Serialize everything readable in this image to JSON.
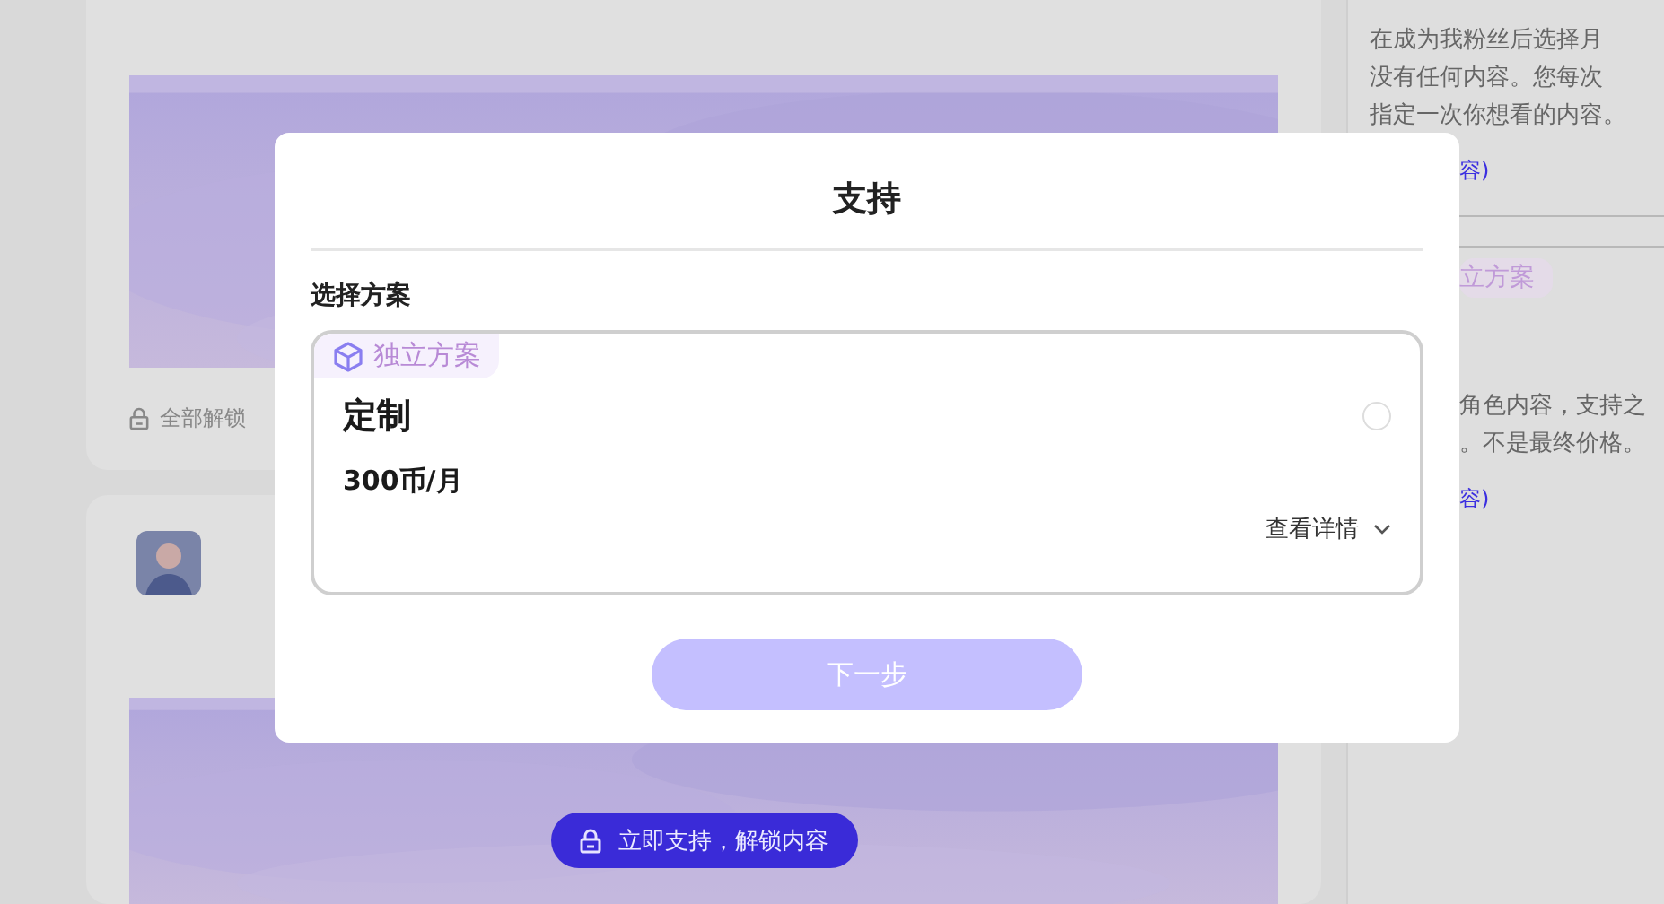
{
  "feed": {
    "posts": [
      {
        "footer": "全部解锁"
      },
      {
        "unlock_button": "立即支持，解锁内容"
      }
    ]
  },
  "side_panel": {
    "top_lines": [
      "在成为我粉丝后选择月",
      "没有任何内容。您每次",
      "指定一次你想看的内容。"
    ],
    "top_link": "容)",
    "tag": "立方案",
    "lines": [
      "角色内容，支持之",
      "。不是最终价格。"
    ],
    "link": "容)"
  },
  "modal": {
    "title": "支持",
    "section_label": "选择方案",
    "plans": [
      {
        "tag": "独立方案",
        "name": "定制",
        "price": "300币/月",
        "details_link": "查看详情",
        "selected": false
      }
    ],
    "next_button": {
      "label": "下一步",
      "disabled": true
    }
  }
}
